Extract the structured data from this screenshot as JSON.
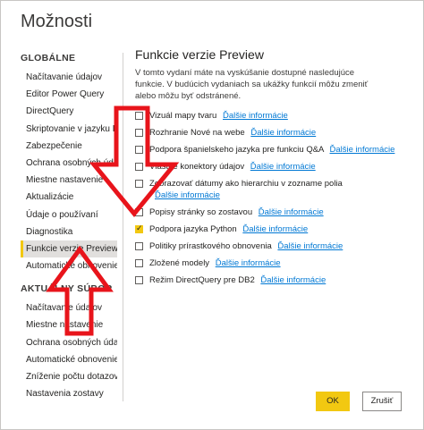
{
  "window": {
    "title": "Možnosti"
  },
  "sidebar": {
    "global": {
      "heading": "GLOBÁLNE",
      "items": [
        "Načítavanie údajov",
        "Editor Power Query",
        "DirectQuery",
        "Skriptovanie v jazyku R",
        "Zabezpečenie",
        "Ochrana osobných údajov",
        "Miestne nastavenie",
        "Aktualizácie",
        "Údaje o používaní",
        "Diagnostika",
        "Funkcie verzie Preview",
        "Automatické obnovenie"
      ],
      "selected_index": 10
    },
    "current_file": {
      "heading": "AKTUÁLNY SÚBOR",
      "items": [
        "Načítavanie údajov",
        "Miestne nastavenie",
        "Ochrana osobných údajov",
        "Automatické obnovenie",
        "Zníženie počtu dotazov",
        "Nastavenia zostavy"
      ]
    }
  },
  "main": {
    "title": "Funkcie verzie Preview",
    "description": "V tomto vydaní máte na vyskúšanie dostupné nasledujúce funkcie. V budúcich vydaniach sa ukážky funkcií môžu zmeniť alebo môžu byť odstránené.",
    "link_label": "Ďalšie informácie",
    "options": [
      {
        "label": "Vizuál mapy tvaru",
        "checked": false
      },
      {
        "label": "Rozhranie Nové na webe",
        "checked": false
      },
      {
        "label": "Podpora španielskeho jazyka pre funkciu Q&A",
        "checked": false
      },
      {
        "label": "Vlastné konektory údajov",
        "checked": false
      },
      {
        "label": "Zobrazovať dátumy ako hierarchiu v zozname polia",
        "checked": false
      },
      {
        "label": "Popisy stránky so zostavou",
        "checked": false
      },
      {
        "label": "Podpora jazyka Python",
        "checked": true
      },
      {
        "label": "Politiky prírastkového obnovenia",
        "checked": false
      },
      {
        "label": "Zložené modely",
        "checked": false
      },
      {
        "label": "Režim DirectQuery pre DB2",
        "checked": false
      }
    ]
  },
  "footer": {
    "ok_label": "OK",
    "cancel_label": "Zrušiť"
  },
  "colors": {
    "accent": "#f2c811",
    "link": "#0078d4",
    "annotation_arrow": "#e8141b"
  }
}
